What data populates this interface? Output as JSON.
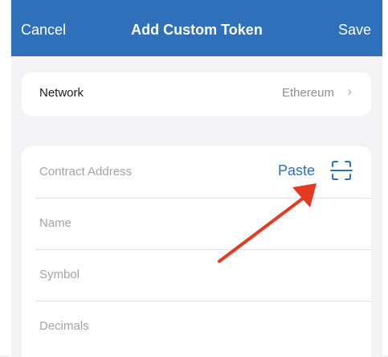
{
  "nav": {
    "cancel_label": "Cancel",
    "title": "Add Custom Token",
    "save_label": "Save"
  },
  "network": {
    "label": "Network",
    "value": "Ethereum",
    "chevron": "›"
  },
  "fields": {
    "contract_address": {
      "placeholder": "Contract Address",
      "paste_label": "Paste",
      "scan_icon": "scan-qr-icon"
    },
    "name": {
      "placeholder": "Name"
    },
    "symbol": {
      "placeholder": "Symbol"
    },
    "decimals": {
      "placeholder": "Decimals"
    }
  },
  "annotation": {
    "arrow_color": "#e53a22"
  },
  "colors": {
    "nav_bg": "#2e70b9",
    "accent": "#2e6fc0",
    "page_bg": "#f3f3f6"
  }
}
